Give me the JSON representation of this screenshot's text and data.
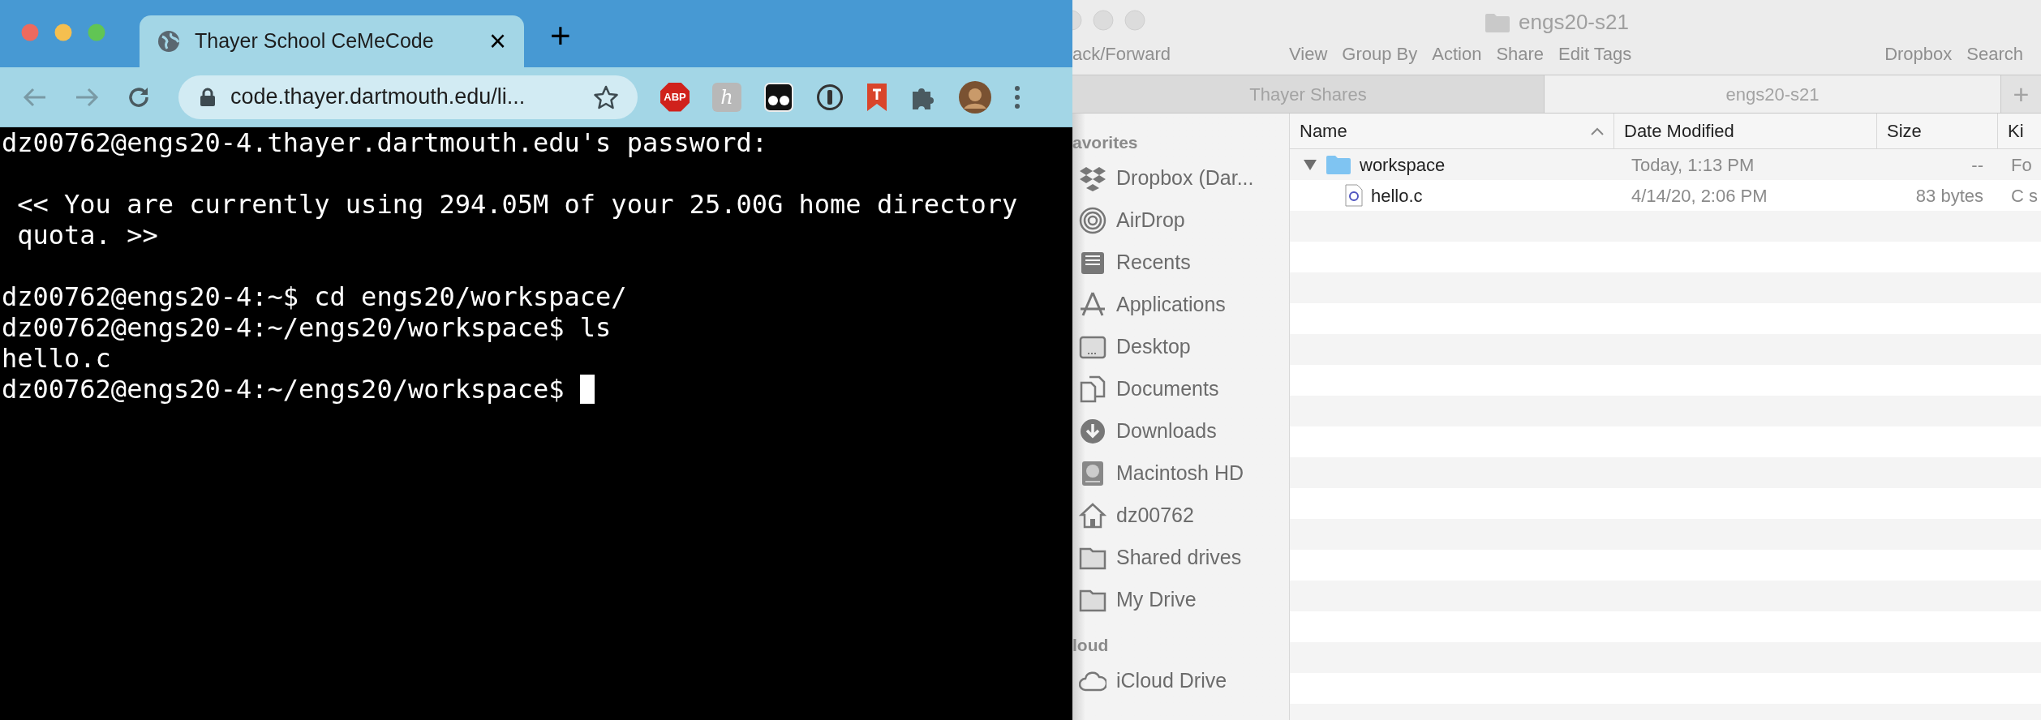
{
  "browser": {
    "tab": {
      "title": "Thayer School CeMeCode",
      "close": "×"
    },
    "new_tab": "+",
    "address": "code.thayer.dartmouth.edu/li...",
    "extensions": [
      {
        "kind": "abp",
        "label": "ABP"
      },
      {
        "kind": "letter",
        "label": "h"
      },
      {
        "kind": "glasses"
      },
      {
        "kind": "password"
      },
      {
        "kind": "bookmark"
      },
      {
        "kind": "puzzle"
      },
      {
        "kind": "avatar"
      },
      {
        "kind": "menu"
      }
    ]
  },
  "terminal": {
    "lines": [
      {
        "kind": "text",
        "text": "dz00762@engs20-4.thayer.dartmouth.edu's password:"
      },
      {
        "kind": "blank"
      },
      {
        "kind": "text",
        "text": " << You are currently using 294.05M of your 25.00G home directory"
      },
      {
        "kind": "text",
        "text": " quota. >>"
      },
      {
        "kind": "blank"
      },
      {
        "kind": "text",
        "text": "dz00762@engs20-4:~$ cd engs20/workspace/"
      },
      {
        "kind": "text",
        "text": "dz00762@engs20-4:~/engs20/workspace$ ls"
      },
      {
        "kind": "text",
        "text": "hello.c"
      },
      {
        "kind": "text",
        "text": "dz00762@engs20-4:~/engs20/workspace$ ",
        "cursor": true
      }
    ]
  },
  "finder": {
    "title": "engs20-s21",
    "toolbar_left": "ack/Forward",
    "toolbar_middle": [
      "View",
      "Group By",
      "Action",
      "Share",
      "Edit Tags"
    ],
    "toolbar_right": [
      "Dropbox",
      "Search"
    ],
    "tabs": [
      {
        "label": "Thayer Shares",
        "selected": false
      },
      {
        "label": "engs20-s21",
        "selected": true
      }
    ],
    "new_tab": "+",
    "sidebar": [
      {
        "heading": "avorites",
        "items": [
          {
            "kind": "dropbox",
            "label": "Dropbox (Dar..."
          },
          {
            "kind": "airdrop",
            "label": "AirDrop"
          },
          {
            "kind": "recents",
            "label": "Recents"
          },
          {
            "kind": "applications",
            "label": "Applications"
          },
          {
            "kind": "desktop",
            "label": "Desktop"
          },
          {
            "kind": "documents",
            "label": "Documents"
          },
          {
            "kind": "downloads",
            "label": "Downloads"
          },
          {
            "kind": "disk",
            "label": "Macintosh HD"
          },
          {
            "kind": "home",
            "label": "dz00762"
          },
          {
            "kind": "folder",
            "label": "Shared drives"
          },
          {
            "kind": "folder",
            "label": "My Drive"
          }
        ]
      },
      {
        "heading": "loud",
        "items": [
          {
            "kind": "cloud",
            "label": "iCloud Drive"
          }
        ]
      }
    ],
    "columns": [
      {
        "label": "Name",
        "sorted": true
      },
      {
        "label": "Date Modified",
        "sorted": false
      },
      {
        "label": "Size",
        "sorted": false
      },
      {
        "label": "Ki",
        "sorted": false
      }
    ],
    "rows": [
      {
        "kind": "folder",
        "name": "workspace",
        "date_modified": "Today, 1:13 PM",
        "size": "--",
        "column_4": "Fo",
        "expanded": true,
        "children": [
          {
            "kind": "file",
            "name": "hello.c",
            "date_modified": "4/14/20, 2:06 PM",
            "size": "83 bytes",
            "column_4": "C s"
          }
        ]
      }
    ]
  }
}
